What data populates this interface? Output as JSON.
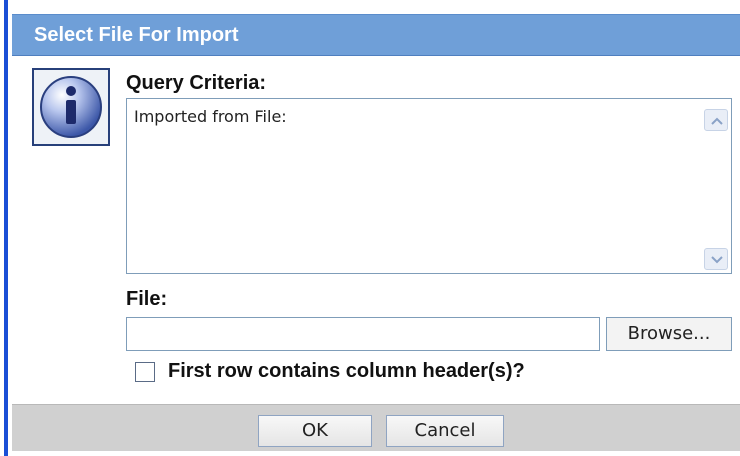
{
  "dialog": {
    "title": "Select File For Import",
    "criteria_label": "Query Criteria:",
    "criteria_text": "Imported from File:",
    "file_label": "File:",
    "file_value": "",
    "browse_label": "Browse...",
    "checkbox_label": "First row contains column header(s)?",
    "checkbox_checked": false,
    "ok_label": "OK",
    "cancel_label": "Cancel"
  },
  "icons": {
    "info": "info-icon",
    "scroll_up": "chevron-up-icon",
    "scroll_down": "chevron-down-icon"
  },
  "colors": {
    "title_bar": "#6f9fd8",
    "footer": "#d0d0d0",
    "accent_left": "#1a4fd6"
  }
}
